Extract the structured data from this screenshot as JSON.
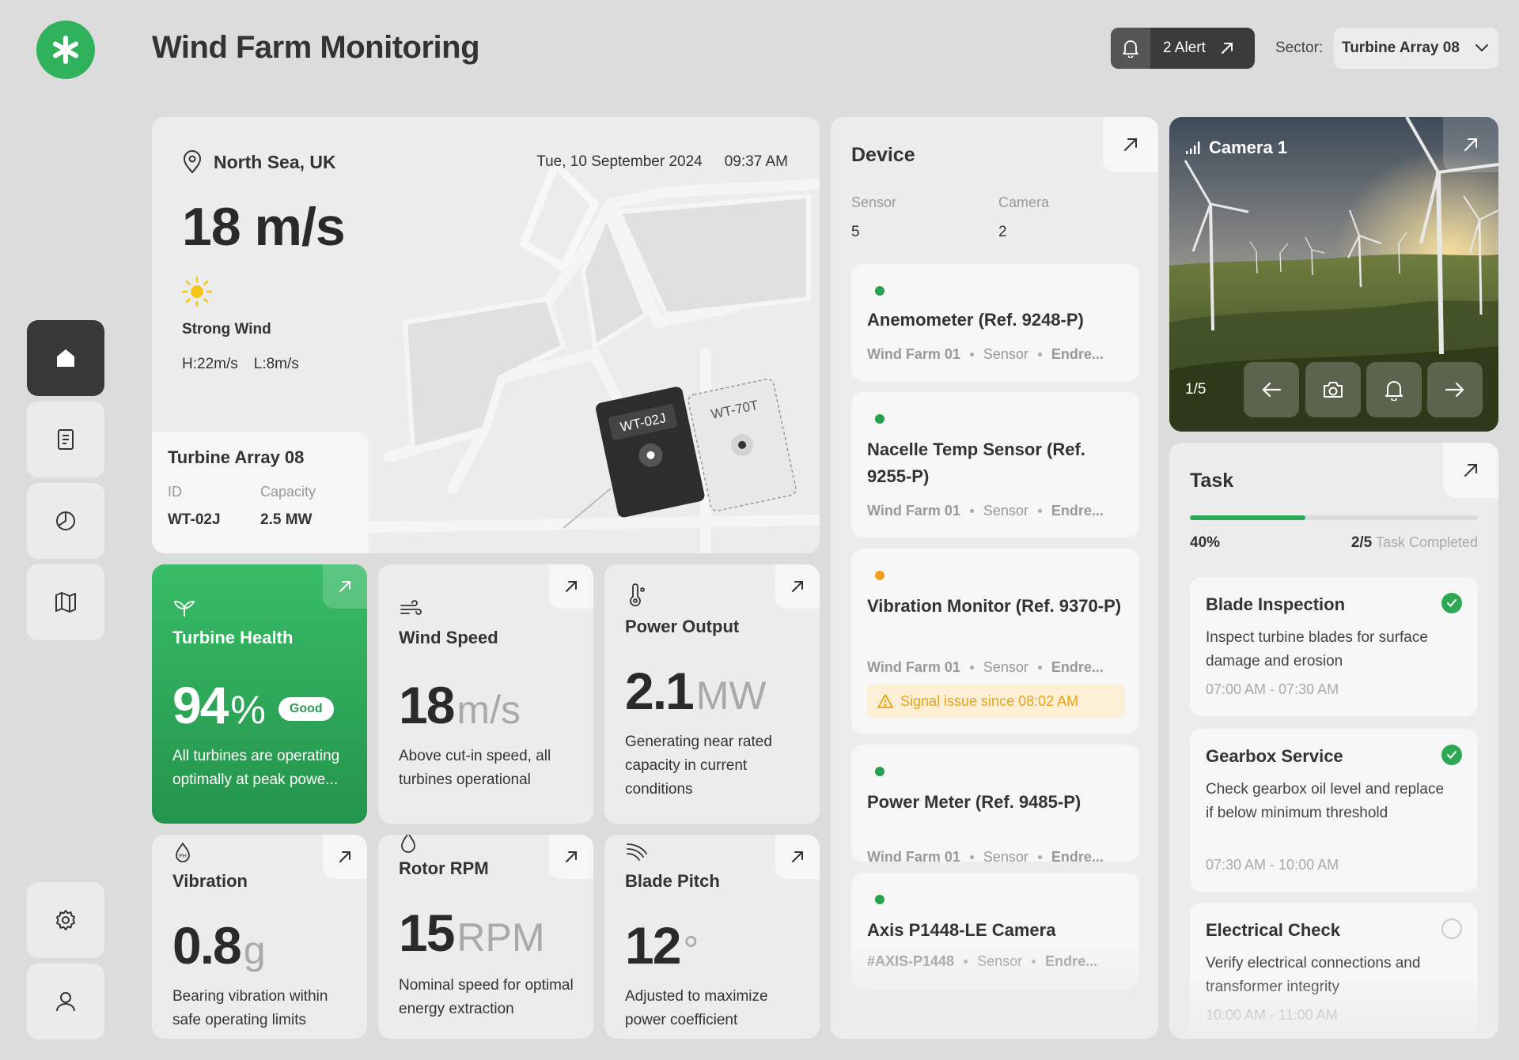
{
  "header": {
    "title": "Wind Farm Monitoring",
    "alert_label": "2 Alert",
    "sector_label": "Sector:",
    "sector_value": "Turbine Array 08"
  },
  "location": {
    "place": "North Sea, UK",
    "date": "Tue, 10 September 2024",
    "time": "09:37 AM",
    "wind_speed": "18 m/s",
    "condition": "Strong Wind",
    "high": "H:22m/s",
    "low": "L:8m/s",
    "map_markers": [
      "WT-02J",
      "WT-70T"
    ]
  },
  "turbine_info": {
    "title": "Turbine Array 08",
    "id_label": "ID",
    "id_value": "WT-02J",
    "capacity_label": "Capacity",
    "capacity_value": "2.5 MW"
  },
  "metrics": {
    "health": {
      "title": "Turbine Health",
      "value": "94",
      "unit": "%",
      "badge": "Good",
      "desc": "All turbines are operating optimally at peak powe..."
    },
    "wind": {
      "title": "Wind Speed",
      "value": "18",
      "unit": "m/s",
      "desc": "Above cut-in speed, all turbines operational"
    },
    "power": {
      "title": "Power Output",
      "value": "2.1",
      "unit": "MW",
      "desc": "Generating near rated capacity in current conditions"
    },
    "vibration": {
      "title": "Vibration",
      "value": "0.8",
      "unit": "g",
      "desc": "Bearing vibration within safe operating limits"
    },
    "rpm": {
      "title": "Rotor RPM",
      "value": "15",
      "unit": "RPM",
      "desc": "Nominal speed for optimal energy extraction"
    },
    "pitch": {
      "title": "Blade Pitch",
      "value": "12",
      "unit": "°",
      "desc": "Adjusted to maximize power coefficient"
    }
  },
  "device": {
    "title": "Device",
    "sensor_label": "Sensor",
    "sensor_count": "5",
    "camera_label": "Camera",
    "camera_count": "2",
    "items": [
      {
        "name": "Anemometer (Ref. 9248-P)",
        "farm": "Wind Farm 01",
        "type": "Sensor",
        "loc": "Endre..."
      },
      {
        "name": "Nacelle Temp Sensor (Ref. 9255-P)",
        "farm": "Wind Farm 01",
        "type": "Sensor",
        "loc": "Endre..."
      },
      {
        "name": "Vibration Monitor (Ref. 9370-P)",
        "farm": "Wind Farm 01",
        "type": "Sensor",
        "loc": "Endre...",
        "warning": "Signal issue since 08:02 AM"
      },
      {
        "name": "Power Meter (Ref. 9485-P)",
        "farm": "Wind Farm 01",
        "type": "Sensor",
        "loc": "Endre..."
      },
      {
        "name": "Axis P1448-LE Camera",
        "farm": "#AXIS-P1448",
        "type": "Sensor",
        "loc": "Endre..."
      }
    ]
  },
  "camera": {
    "title": "Camera 1",
    "counter": "1/5"
  },
  "task": {
    "title": "Task",
    "progress": 0.4,
    "percent": "40%",
    "done": "2/5",
    "done_label": "Task Completed",
    "items": [
      {
        "name": "Blade Inspection",
        "desc": "Inspect turbine blades for surface damage and erosion",
        "time": "07:00 AM - 07:30 AM",
        "done": true
      },
      {
        "name": "Gearbox Service",
        "desc": "Check gearbox oil level and replace if below minimum threshold",
        "time": "07:30 AM - 10:00 AM",
        "done": true
      },
      {
        "name": "Electrical Check",
        "desc": "Verify electrical connections and transformer integrity",
        "time": "10:00 AM - 11:00 AM",
        "done": false
      }
    ]
  },
  "colors": {
    "accent": "#2fb25b",
    "dark": "#383838",
    "warning": "#f0a020"
  }
}
